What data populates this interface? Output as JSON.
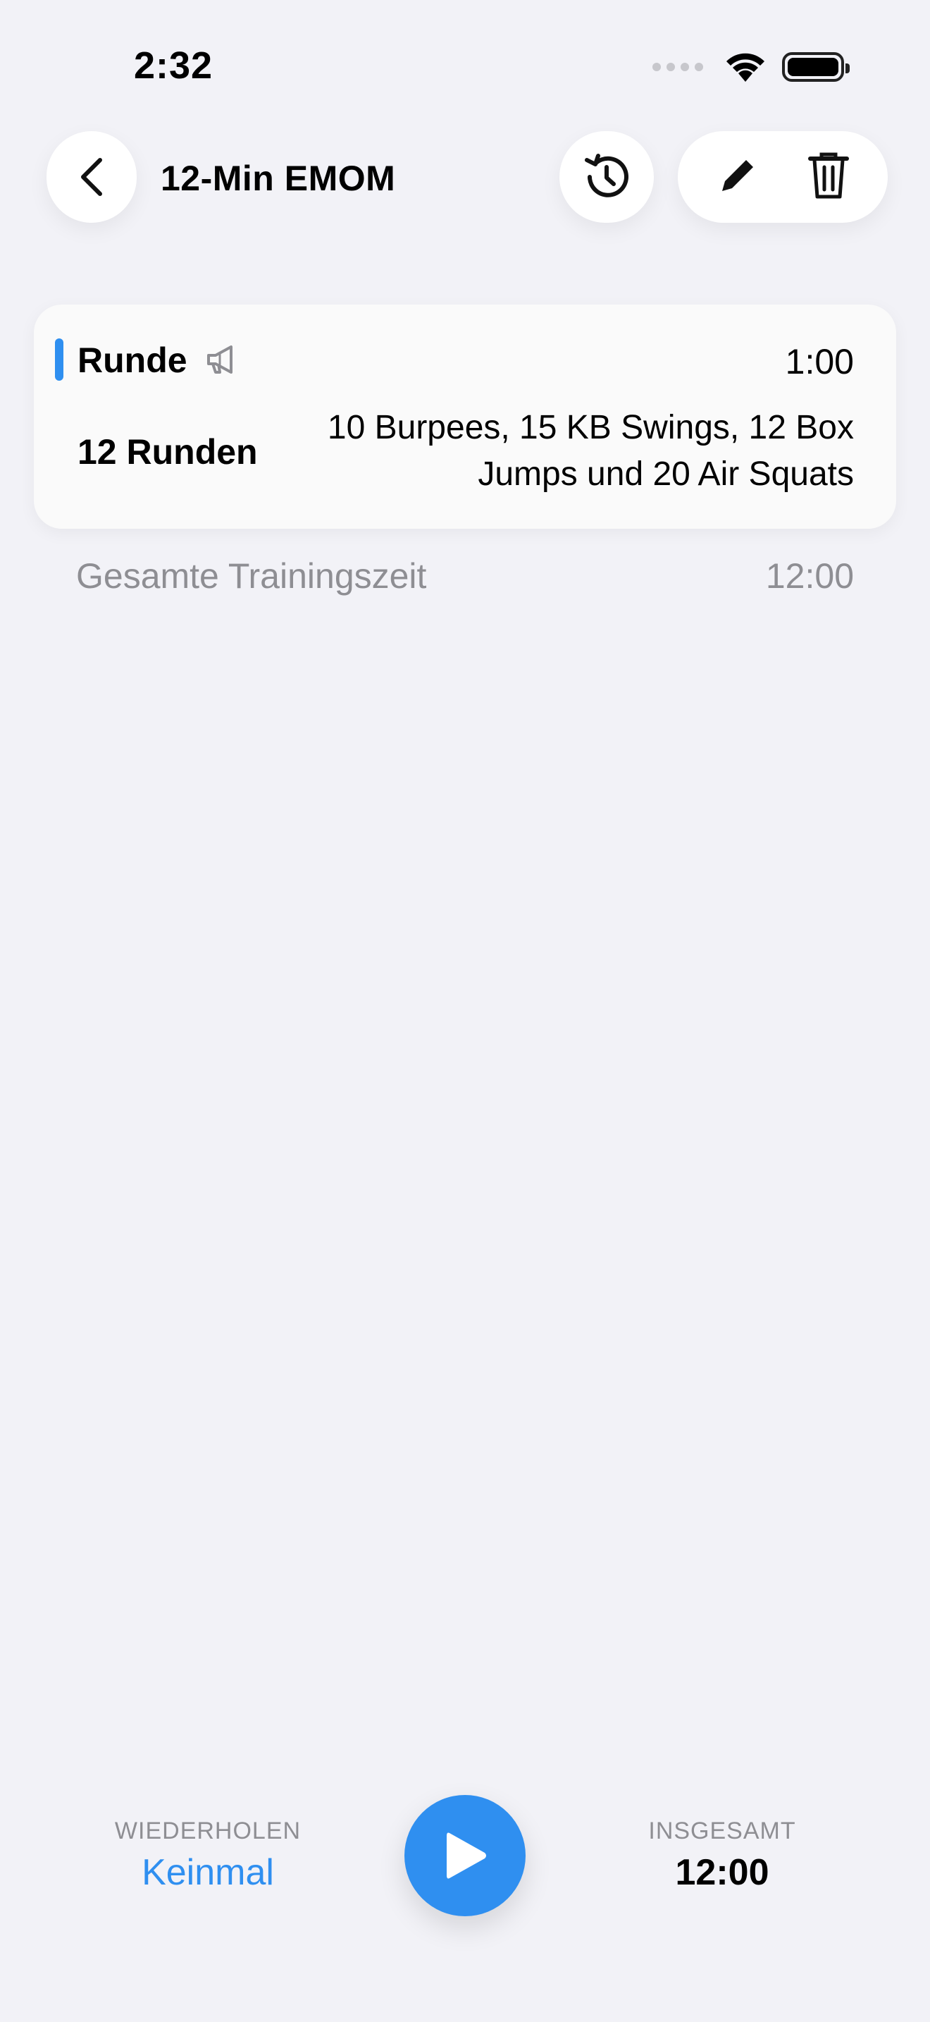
{
  "status_bar": {
    "time": "2:32"
  },
  "header": {
    "title": "12-Min EMOM",
    "icons": {
      "back": "chevron-left-icon",
      "history": "history-icon",
      "edit": "pencil-icon",
      "delete": "trash-icon"
    }
  },
  "interval": {
    "title": "Runde",
    "duration": "1:00",
    "rounds": "12 Runden",
    "description": "10 Burpees, 15 KB Swings, 12 Box Jumps und 20 Air Squats",
    "accent_color": "#2F8FF0"
  },
  "summary": {
    "label": "Gesamte Trainingszeit",
    "value": "12:00"
  },
  "bottom": {
    "repeat_label": "WIEDERHOLEN",
    "repeat_value": "Keinmal",
    "total_label": "INSGESAMT",
    "total_value": "12:00",
    "play_color": "#2F8FF0"
  }
}
